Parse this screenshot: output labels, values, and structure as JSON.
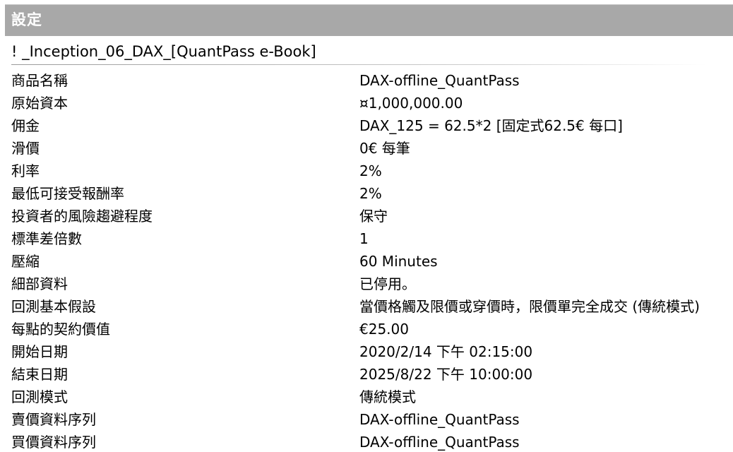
{
  "header": {
    "title": "設定"
  },
  "strategy": {
    "title": "! _Inception_06_DAX_[QuantPass e-Book]"
  },
  "settings": [
    {
      "label": "商品名稱",
      "value": "DAX-offline_QuantPass"
    },
    {
      "label": "原始資本",
      "value": "¤1,000,000.00"
    },
    {
      "label": "佣金",
      "value": "DAX_125 = 62.5*2 [固定式62.5€ 每口]"
    },
    {
      "label": "滑價",
      "value": "0€ 每筆"
    },
    {
      "label": "利率",
      "value": "2%"
    },
    {
      "label": "最低可接受報酬率",
      "value": "2%"
    },
    {
      "label": "投資者的風險趨避程度",
      "value": "保守"
    },
    {
      "label": "標準差倍數",
      "value": "1"
    },
    {
      "label": "壓縮",
      "value": "60 Minutes"
    },
    {
      "label": "細部資料",
      "value": "已停用。"
    },
    {
      "label": "回測基本假設",
      "value": "當價格觸及限價或穿價時，限價單完全成交 (傳統模式)"
    },
    {
      "label": "每點的契約價值",
      "value": "€25.00"
    },
    {
      "label": "開始日期",
      "value": "2020/2/14 下午 02:15:00"
    },
    {
      "label": "結束日期",
      "value": "2025/8/22 下午 10:00:00"
    },
    {
      "label": "回測模式",
      "value": "傳統模式"
    },
    {
      "label": "賣價資料序列",
      "value": "DAX-offline_QuantPass"
    },
    {
      "label": "買價資料序列",
      "value": "DAX-offline_QuantPass"
    }
  ]
}
